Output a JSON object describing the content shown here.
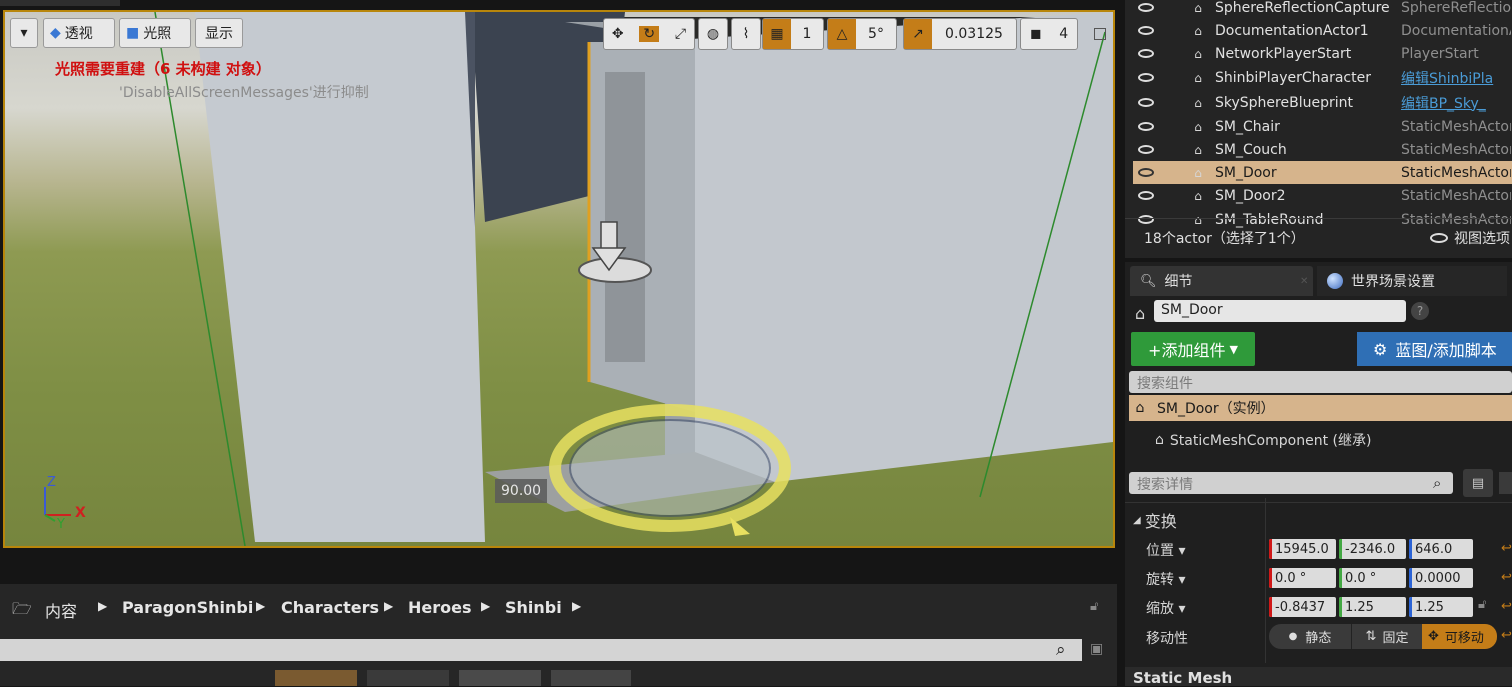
{
  "viewport": {
    "view_mode": "透视",
    "lighting": "光照",
    "show": "显示",
    "lighting_warning": "光照需要重建（6 未构建 对象）",
    "suppress_hint": "'DisableAllScreenMessages'进行抑制",
    "rotation_readout": "90.00",
    "axis_labels": {
      "z": "Z",
      "x": "X",
      "y": "Y"
    },
    "toolbar": {
      "grid_value": "1",
      "rotation_snap": "5°",
      "scale_snap": "0.03125",
      "camera_speed": "4"
    }
  },
  "outliner": {
    "rows": [
      {
        "name": "SphereReflectionCapture",
        "type": "SphereReflectionC",
        "link": false,
        "selected": false
      },
      {
        "name": "DocumentationActor1",
        "type": "DocumentationActor",
        "link": false,
        "selected": false
      },
      {
        "name": "NetworkPlayerStart",
        "type": "PlayerStart",
        "link": false,
        "selected": false
      },
      {
        "name": "ShinbiPlayerCharacter",
        "type": "编辑ShinbiPla",
        "link": true,
        "selected": false
      },
      {
        "name": "SkySphereBlueprint",
        "type": "编辑BP_Sky_",
        "link": true,
        "selected": false
      },
      {
        "name": "SM_Chair",
        "type": "StaticMeshActor",
        "link": false,
        "selected": false
      },
      {
        "name": "SM_Couch",
        "type": "StaticMeshActor",
        "link": false,
        "selected": false
      },
      {
        "name": "SM_Door",
        "type": "StaticMeshActor",
        "link": false,
        "selected": true
      },
      {
        "name": "SM_Door2",
        "type": "StaticMeshActor",
        "link": false,
        "selected": false
      },
      {
        "name": "SM_TableRound",
        "type": "StaticMeshActor",
        "link": false,
        "selected": false
      }
    ],
    "status": "18个actor（选择了1个）",
    "view_options": "视图选项"
  },
  "details": {
    "tab_details": "细节",
    "tab_world": "世界场景设置",
    "actor_name": "SM_Door",
    "add_component": "+添加组件",
    "blueprint_button": "蓝图/添加脚本",
    "search_components_placeholder": "搜索组件",
    "component_root": "SM_Door（实例）",
    "component_child": "StaticMeshComponent (继承)",
    "search_details_placeholder": "搜索详情",
    "transform_section": "变换",
    "location_label": "位置",
    "rotation_label": "旋转",
    "scale_label": "缩放",
    "mobility_label": "移动性",
    "location": [
      "15945.0",
      "-2346.0",
      "646.0"
    ],
    "rotation": [
      "0.0 °",
      "0.0 °",
      "0.0000"
    ],
    "scale": [
      "-0.8437",
      "1.25",
      "1.25"
    ],
    "mobility": {
      "static": "静态",
      "stationary": "固定",
      "movable": "可移动"
    },
    "next_section": "Static Mesh"
  },
  "content_browser": {
    "root": "内容",
    "path": [
      "ParagonShinbi",
      "Characters",
      "Heroes",
      "Shinbi"
    ]
  },
  "colors": {
    "accent_orange": "#c47d18",
    "selection": "#d6b48c",
    "link_blue": "#4a9bd6",
    "add_green": "#2f9a3a",
    "blueprint_blue": "#2f6fb5"
  }
}
